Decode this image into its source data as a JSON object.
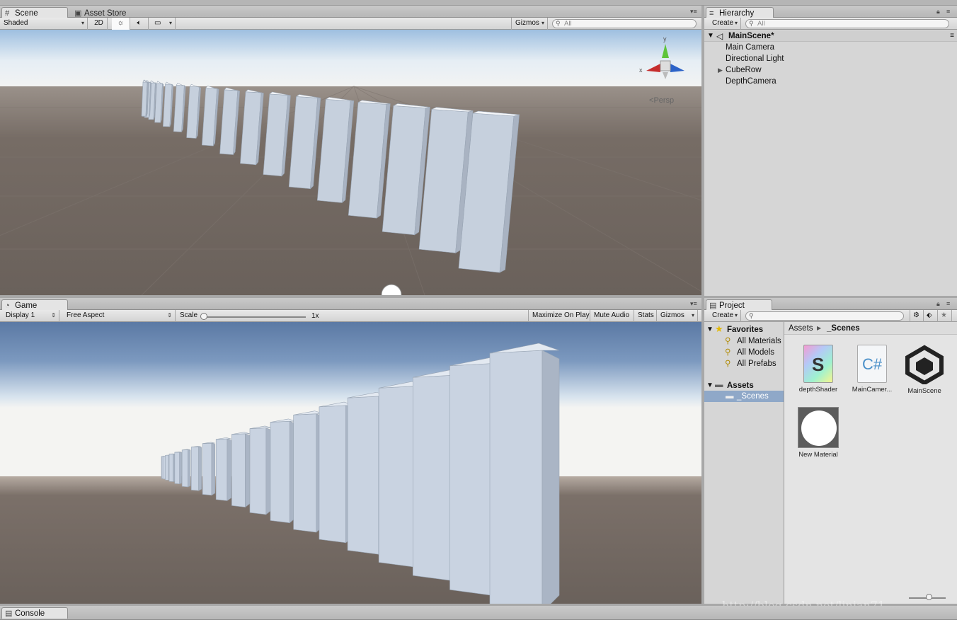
{
  "scene": {
    "tabs": [
      {
        "label": "Scene",
        "icon": "grid-icon"
      },
      {
        "label": "Asset Store",
        "icon": "store-icon"
      }
    ],
    "shading_mode": "Shaded",
    "btn_2d": "2D",
    "gizmos": "Gizmos",
    "search_placeholder": "All",
    "persp": "Persp",
    "axis_y": "y",
    "axis_x": "x"
  },
  "hierarchy": {
    "tab": "Hierarchy",
    "create": "Create",
    "search_placeholder": "All",
    "scene_name": "MainScene*",
    "items": [
      "Main Camera",
      "Directional Light",
      "CubeRow",
      "DepthCamera"
    ]
  },
  "game": {
    "tab": "Game",
    "display": "Display 1",
    "aspect": "Free Aspect",
    "scale_label": "Scale",
    "scale_value": "1x",
    "maximize": "Maximize On Play",
    "mute": "Mute Audio",
    "stats": "Stats",
    "gizmos": "Gizmos"
  },
  "project": {
    "tab": "Project",
    "create": "Create",
    "favorites_label": "Favorites",
    "favorites": [
      "All Materials",
      "All Models",
      "All Prefabs"
    ],
    "assets_label": "Assets",
    "scenes_folder": "_Scenes",
    "breadcrumb": [
      "Assets",
      "_Scenes"
    ],
    "assets": [
      {
        "name": "depthShader",
        "icon": "shader-icon"
      },
      {
        "name": "MainCamer...",
        "icon": "csharp-script-icon"
      },
      {
        "name": "MainScene",
        "icon": "unity-scene-icon"
      },
      {
        "name": "New Material",
        "icon": "material-sphere-icon"
      }
    ]
  },
  "console": {
    "tab": "Console"
  },
  "watermark": "http://blog.csdn.net/linian71",
  "colors": {
    "ground": "#6b625c",
    "sky": "#a9c6e0",
    "pillar": "#c9d3e0",
    "selection": "#8fa8c8"
  }
}
